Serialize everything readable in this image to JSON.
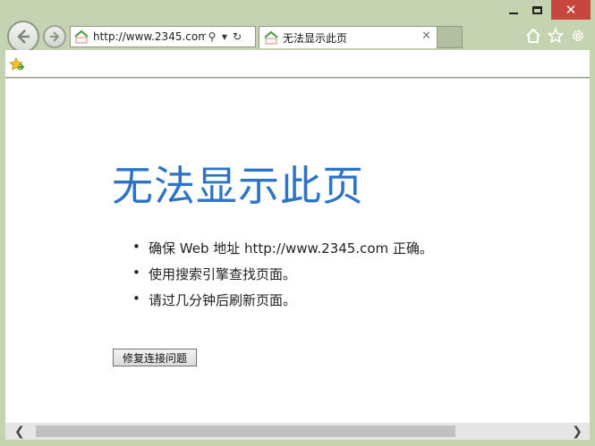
{
  "browser": {
    "address_url": "http://www.2345.com/",
    "tab_title": "无法显示此页",
    "icons": {
      "back": "back-arrow-icon",
      "forward": "forward-arrow-icon",
      "search": "search-icon",
      "refresh": "refresh-icon",
      "home": "home-icon",
      "favorites": "star-icon",
      "tools": "gear-icon",
      "close": "close-icon"
    },
    "colors": {
      "frame": "#c5d3b0",
      "close_button": "#c7463d",
      "title_blue": "#2d74c4"
    }
  },
  "page": {
    "title": "无法显示此页",
    "tips": [
      "确保 Web 地址 http://www.2345.com 正确。",
      "使用搜索引擎查找页面。",
      "请过几分钟后刷新页面。"
    ],
    "fix_button": "修复连接问题"
  }
}
